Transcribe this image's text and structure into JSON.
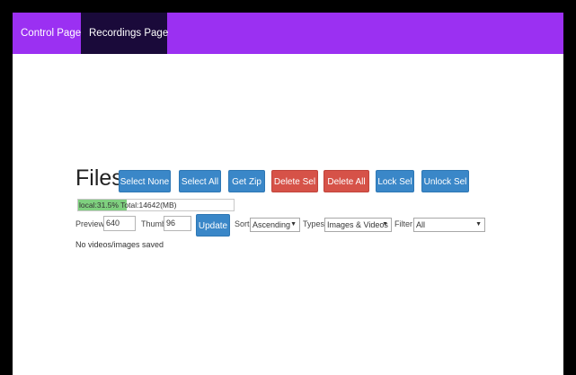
{
  "nav": {
    "control_label": "Control Page",
    "recordings_label": "Recordings Page"
  },
  "files": {
    "title": "Files",
    "buttons": {
      "select_none": "Select None",
      "select_all": "Select All",
      "get_zip": "Get Zip",
      "delete_sel": "Delete Sel",
      "delete_all": "Delete All",
      "lock_sel": "Lock Sel",
      "unlock_sel": "Unlock Sel"
    },
    "storage": {
      "text": "local:31.5% Total:14642(MB)",
      "used_percent": 31.5
    },
    "controls": {
      "preview_label": "Preview",
      "preview_value": "640",
      "thumb_label": "Thumb",
      "thumb_value": "96",
      "update_label": "Update",
      "sort_label": "Sort",
      "sort_value": "Ascending",
      "types_label": "Types",
      "types_value": "Images & Videos",
      "filter_label": "Filter",
      "filter_value": "All"
    },
    "status": "No videos/images saved"
  },
  "colors": {
    "navbar": "#9b30f2",
    "nav_active": "#1a0a3a",
    "primary_button": "#3a87c8",
    "danger_button": "#d65248",
    "progress_fill": "#7fd07f"
  }
}
